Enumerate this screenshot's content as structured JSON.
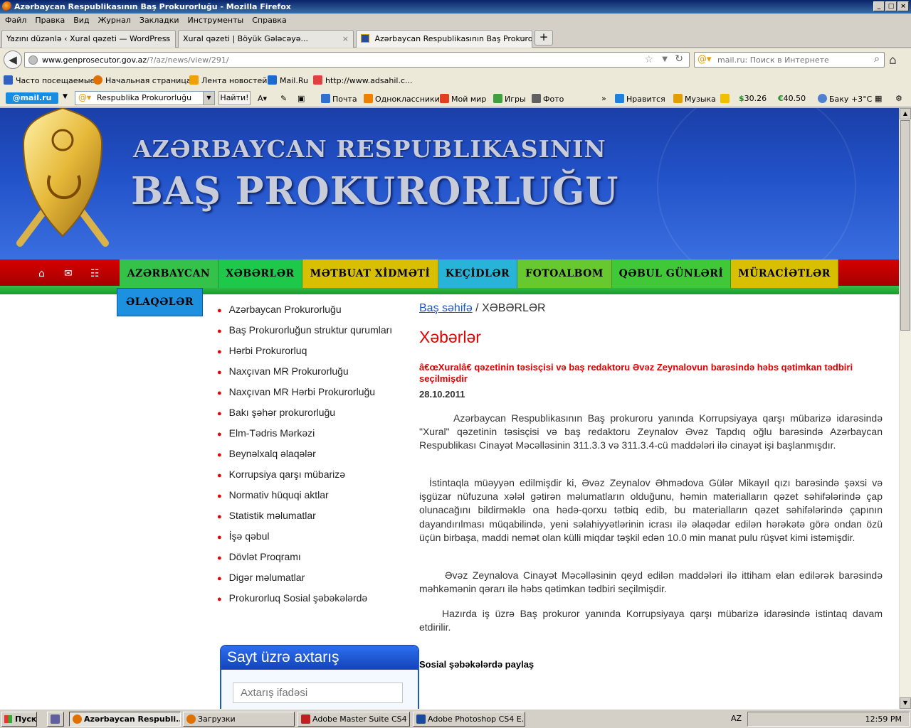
{
  "window": {
    "title": "Azərbaycan Respublikasının Baş Prokurorluğu - Mozilla Firefox",
    "controls": [
      "_",
      "□",
      "×"
    ]
  },
  "menu": [
    "Файл",
    "Правка",
    "Вид",
    "Журнал",
    "Закладки",
    "Инструменты",
    "Справка"
  ],
  "tabs": [
    {
      "label": "Yazını düzənlə ‹ Xural qəzeti — WordPress",
      "active": false
    },
    {
      "label": "Xural qəzeti | Böyük Gələcəyə...",
      "active": false
    },
    {
      "label": "Azərbaycan Respublikasının Baş Prokurorl...",
      "active": true
    }
  ],
  "tab_close": "×",
  "new_tab": "+",
  "nav": {
    "url_domain": "www.genprosecutor.gov.az",
    "url_path": "/?/az/news/view/291/",
    "search_placeholder": "mail.ru: Поиск в Интернете"
  },
  "bookmarks": [
    {
      "label": "Часто посещаемые",
      "color": "#3060c0"
    },
    {
      "label": "Начальная страница",
      "color": "#e07000"
    },
    {
      "label": "Лента новостей",
      "color": "#f0a000"
    },
    {
      "label": "Mail.Ru",
      "color": "#1a6ad0"
    },
    {
      "label": "http://www.adsahil.c...",
      "color": "#e04040"
    }
  ],
  "mailru_toolbar": {
    "logo": "@mail.ru",
    "search_value": "Respublika Prokurorluğu",
    "find_button": "Найти!",
    "items": [
      {
        "label": "Почта",
        "color": "#3070d0"
      },
      {
        "label": "Одноклассники",
        "color": "#f08000"
      },
      {
        "label": "Мой мир",
        "color": "#e04020"
      },
      {
        "label": "Игры",
        "color": "#40a040"
      },
      {
        "label": "Фото",
        "color": "#606060"
      }
    ],
    "more": "»",
    "right_items": [
      {
        "label": "Нравится",
        "color": "#2080e0"
      },
      {
        "label": "Музыка",
        "color": "#e0a000"
      },
      {
        "label": "",
        "color": "#f0c000"
      },
      {
        "label": "30.26",
        "prefix": "$",
        "color": "#2a8a2a"
      },
      {
        "label": "40.50",
        "prefix": "€",
        "color": "#2a8a2a"
      },
      {
        "label": "Баку +3°C",
        "color": "#5080d0"
      }
    ]
  },
  "site": {
    "title_line1": "AZƏRBAYCAN RESPUBLIKASININ",
    "title_line2": "BAŞ PROKURORLUĞU",
    "nav_icons": [
      "home-icon",
      "mail-icon",
      "sitemap-icon"
    ],
    "nav": [
      {
        "label": "AZƏRBAYCAN",
        "color": "#34c24a"
      },
      {
        "label": "XƏBƏRLƏR",
        "color": "#1ec84a"
      },
      {
        "label": "MƏTBUAT XİDMƏTİ",
        "color": "#d8c000"
      },
      {
        "label": "KEÇİDLƏR",
        "color": "#28b4d8"
      },
      {
        "label": "FOTOALBOM",
        "color": "#68c830"
      },
      {
        "label": "QƏBUL GÜNLƏRİ",
        "color": "#40c838"
      },
      {
        "label": "MÜRACİƏTLƏR",
        "color": "#d8c000"
      }
    ],
    "nav_extra": "ƏLAQƏLƏR"
  },
  "sidebar": [
    "Azərbaycan Prokurorluğu",
    "Baş Prokurorluğun struktur qurumları",
    "Hərbi Prokurorluq",
    "Naxçıvan MR Prokurorluğu",
    "Naxçıvan MR Hərbi Prokurorluğu",
    "Bakı şəhər prokurorluğu",
    "Elm-Tədris Mərkəzi",
    "Beynəlxalq əlaqələr",
    "Korrupsiya qarşı mübarizə",
    "Normativ hüquqi aktlar",
    "Statistik məlumatlar",
    "İşə qəbul",
    "Dövlət Proqramı",
    "Digər məlumatlar",
    "Prokurorluq Sosial şəbəkələrdə"
  ],
  "search_widget": {
    "title": "Sayt üzrə axtarış",
    "placeholder": "Axtarış ifadəsi"
  },
  "article": {
    "breadcrumb_home": "Baş səhifə",
    "breadcrumb_sep": " / ",
    "breadcrumb_current": "XƏBƏRLƏR",
    "page_title": "Xəbərlər",
    "headline": "â€œXuralâ€ qəzetinin təsisçisi və baş redaktoru Əvəz Zeynalovun barəsində həbs qətimkan tədbiri seçilmişdir",
    "date": "28.10.2011",
    "paragraphs": [
      "Azərbaycan Respublikasının Baş prokuroru yanında Korrupsiyaya qarşı mübarizə idarəsində \"Xural\" qəzetinin təsisçisi və baş redaktoru Zeynalov Əvəz Tapdıq oğlu barəsində Azərbaycan Respublikası Cinayət Məcəlləsinin 311.3.3 və 311.3.4-cü maddələri ilə cinayət işi başlanmışdır.",
      "İstintaqla müəyyən edilmişdir ki, Əvəz Zeynalov Əhmədova Gülər Mikayıl qızı barəsində şəxsi və işgüzar nüfuzuna xələl gətirən məlumatların olduğunu, həmin materialların qəzet səhifələrində çap olunacağını bildirməklə ona hədə-qorxu tətbiq edib, bu materialların qəzet səhifələrində çapının dayandırılması müqabilində, yeni səlahiyyətlərinin icrası ilə əlaqədar edilən hərəkətə görə ondan özü üçün birbaşa, maddi nemət olan külli miqdar təşkil edən 10.0 min manat pulu rüşvət kimi istəmişdir.",
      "Əvəz Zeynalova Cinayət Məcəlləsinin qeyd edilən maddələri ilə ittiham elan edilərək barəsində məhkəmənin qərarı ilə həbs qətimkan tədbiri seçilmişdir.",
      "Hazırda iş üzrə Baş prokuror yanında Korrupsiyaya qarşı mübarizə idarəsində istintaq davam etdirilir."
    ],
    "share_label": "Sosial şəbəkələrdə paylaş"
  },
  "taskbar": {
    "start": "Пуск",
    "items": [
      {
        "label": "",
        "color": "#6060a0"
      },
      {
        "label": "Azərbaycan Respubli...",
        "active": true,
        "color": "#e07000"
      },
      {
        "label": "Загрузки",
        "active": false,
        "color": "#e07000"
      },
      {
        "label": "Adobe Master Suite CS4 ...",
        "active": false,
        "color": "#c02020"
      },
      {
        "label": "Adobe Photoshop CS4 E...",
        "active": false,
        "color": "#1a4aa0"
      }
    ],
    "lang": "AZ",
    "clock": "12:59 PM"
  }
}
